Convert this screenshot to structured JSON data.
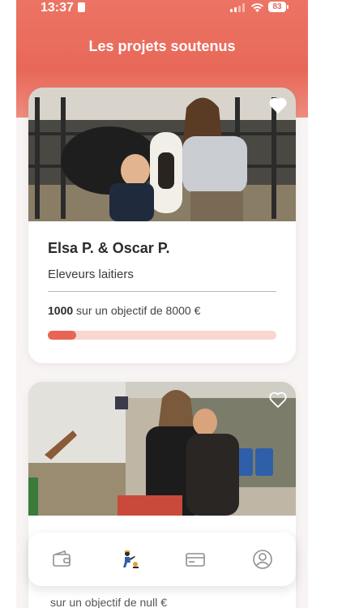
{
  "status_bar": {
    "time": "13:37",
    "battery": "83"
  },
  "header": {
    "title": "Les projets soutenus"
  },
  "projects": [
    {
      "name": "Elsa P. & Oscar P.",
      "role": "Eleveurs laitiers",
      "amount": "1000",
      "goal_text": "sur un objectif de 8000 €",
      "progress": 0.125,
      "favorited": true
    },
    {
      "goal_text": "sur un objectif de null €",
      "favorited": false
    }
  ],
  "nav": {
    "items": [
      "wallet-icon",
      "farmer-icon",
      "card-icon",
      "profile-icon"
    ],
    "active_index": 1
  },
  "colors": {
    "accent": "#e86556",
    "accent_light": "#f9d6d0"
  }
}
